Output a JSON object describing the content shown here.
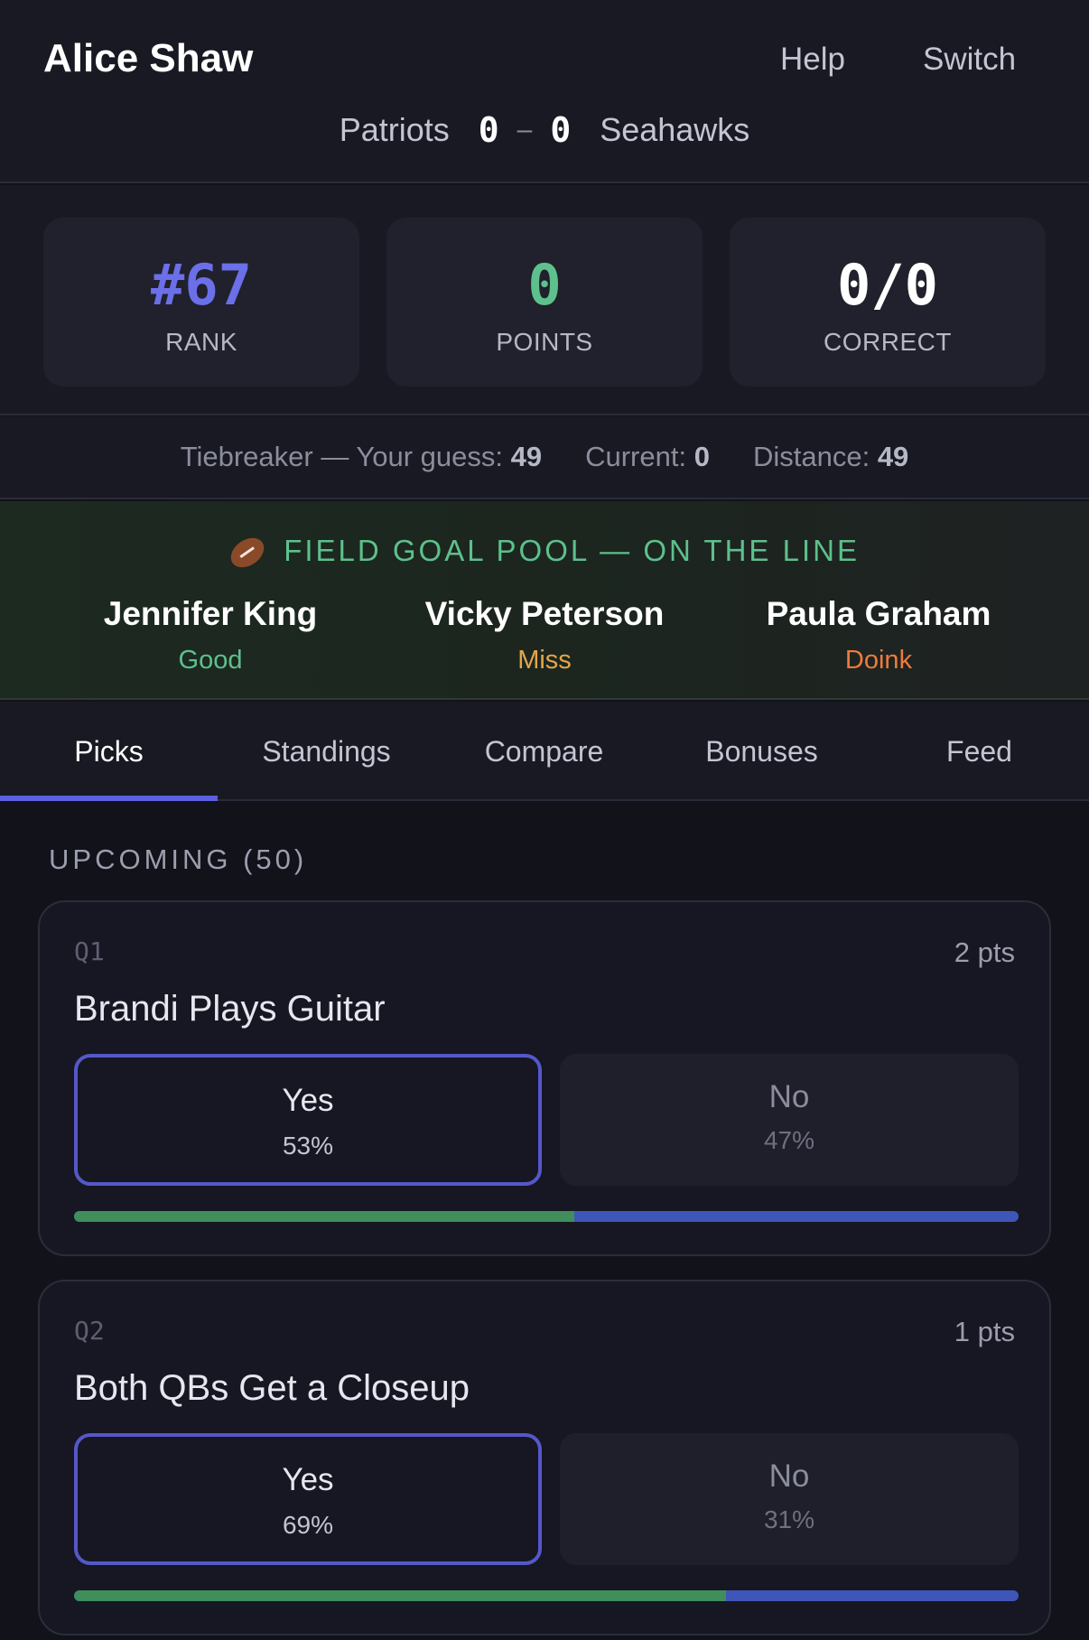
{
  "header": {
    "user_name": "Alice Shaw",
    "help_label": "Help",
    "switch_label": "Switch",
    "game": {
      "home_team": "Patriots",
      "home_score": "0",
      "separator": "–",
      "away_score": "0",
      "away_team": "Seahawks"
    }
  },
  "stats": {
    "rank": {
      "value": "#67",
      "label": "RANK",
      "color": "#6b6fe8"
    },
    "points": {
      "value": "0",
      "label": "POINTS",
      "color": "#5ec08c"
    },
    "correct": {
      "value": "0/0",
      "label": "CORRECT",
      "color": "#ffffff"
    }
  },
  "tiebreaker": {
    "guess_label": "Tiebreaker — Your guess:",
    "guess_value": "49",
    "current_label": "Current:",
    "current_value": "0",
    "distance_label": "Distance:",
    "distance_value": "49"
  },
  "field_goal_pool": {
    "icon": "football-icon",
    "title": "FIELD GOAL POOL — ON THE LINE",
    "picks": [
      {
        "name": "Jennifer King",
        "result": "Good",
        "color": "#5ec08c"
      },
      {
        "name": "Vicky Peterson",
        "result": "Miss",
        "color": "#e3a64a"
      },
      {
        "name": "Paula Graham",
        "result": "Doink",
        "color": "#ee7a3c"
      }
    ]
  },
  "tabs": [
    {
      "label": "Picks",
      "active": true
    },
    {
      "label": "Standings"
    },
    {
      "label": "Compare"
    },
    {
      "label": "Bonuses"
    },
    {
      "label": "Feed"
    }
  ],
  "accent_color": "#5b5fe0",
  "upcoming": {
    "title": "UPCOMING (50)",
    "questions": [
      {
        "number": "Q1",
        "points": "2 pts",
        "text": "Brandi Plays Guitar",
        "yes": {
          "label": "Yes",
          "pct": "53%"
        },
        "no": {
          "label": "No",
          "pct": "47%"
        },
        "yes_share": 0.53
      },
      {
        "number": "Q2",
        "points": "1 pts",
        "text": "Both QBs Get a Closeup",
        "yes": {
          "label": "Yes",
          "pct": "69%"
        },
        "no": {
          "label": "No",
          "pct": "31%"
        },
        "yes_share": 0.69
      }
    ]
  }
}
